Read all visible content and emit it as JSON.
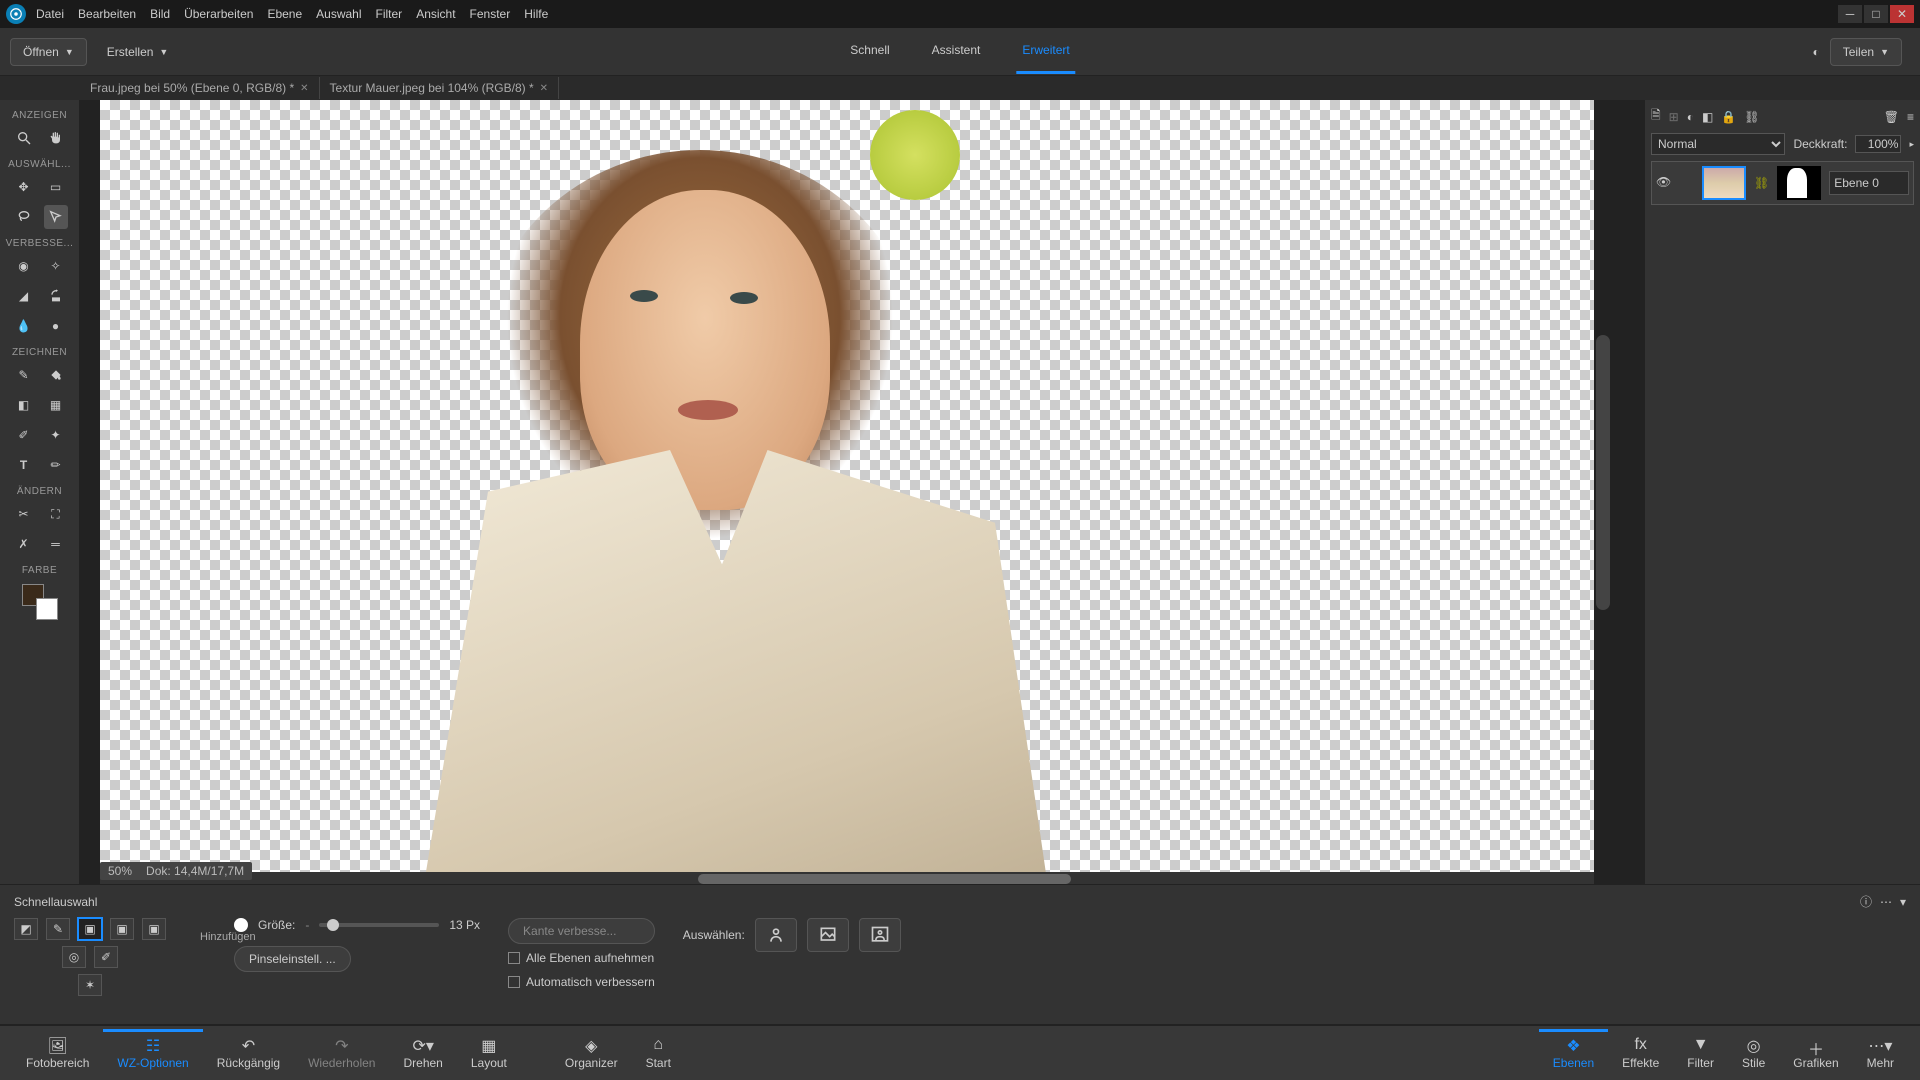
{
  "menu": {
    "items": [
      "Datei",
      "Bearbeiten",
      "Bild",
      "Überarbeiten",
      "Ebene",
      "Auswahl",
      "Filter",
      "Ansicht",
      "Fenster",
      "Hilfe"
    ]
  },
  "topbar": {
    "open": "Öffnen",
    "create": "Erstellen",
    "tabs": {
      "quick": "Schnell",
      "guided": "Assistent",
      "expert": "Erweitert"
    },
    "share": "Teilen"
  },
  "documents": [
    {
      "title": "Frau.jpeg bei 50% (Ebene 0, RGB/8) *"
    },
    {
      "title": "Textur Mauer.jpeg bei 104% (RGB/8) *"
    }
  ],
  "toolGroups": {
    "view": "ANZEIGEN",
    "select": "AUSWÄHL...",
    "enhance": "VERBESSE...",
    "draw": "ZEICHNEN",
    "modify": "ÄNDERN",
    "color": "FARBE"
  },
  "statusbar": {
    "zoom": "50%",
    "doc": "Dok: 14,4M/17,7M"
  },
  "layers": {
    "blendMode": "Normal",
    "opacityLabel": "Deckkraft:",
    "opacityValue": "100%",
    "layer0": "Ebene 0"
  },
  "options": {
    "title": "Schnellauswahl",
    "addLabel": "Hinzufügen",
    "sizeLabel": "Größe:",
    "sizeValue": "13 Px",
    "edgeRefine": "Kante verbesse...",
    "brushSettings": "Pinseleinstell. ...",
    "allLayers": "Alle Ebenen aufnehmen",
    "autoEnhance": "Automatisch verbessern",
    "selectLabel": "Auswählen:"
  },
  "bottombar": {
    "left": [
      {
        "key": "fotobereich",
        "label": "Fotobereich"
      },
      {
        "key": "wzopt",
        "label": "WZ-Optionen"
      },
      {
        "key": "undo",
        "label": "Rückgängig"
      },
      {
        "key": "redo",
        "label": "Wiederholen"
      },
      {
        "key": "rotate",
        "label": "Drehen"
      },
      {
        "key": "layout",
        "label": "Layout"
      }
    ],
    "mid": [
      {
        "key": "organizer",
        "label": "Organizer"
      },
      {
        "key": "start",
        "label": "Start"
      }
    ],
    "right": [
      {
        "key": "ebenen",
        "label": "Ebenen"
      },
      {
        "key": "effekte",
        "label": "Effekte"
      },
      {
        "key": "filter",
        "label": "Filter"
      },
      {
        "key": "stile",
        "label": "Stile"
      },
      {
        "key": "grafiken",
        "label": "Grafiken"
      },
      {
        "key": "mehr",
        "label": "Mehr"
      }
    ]
  }
}
